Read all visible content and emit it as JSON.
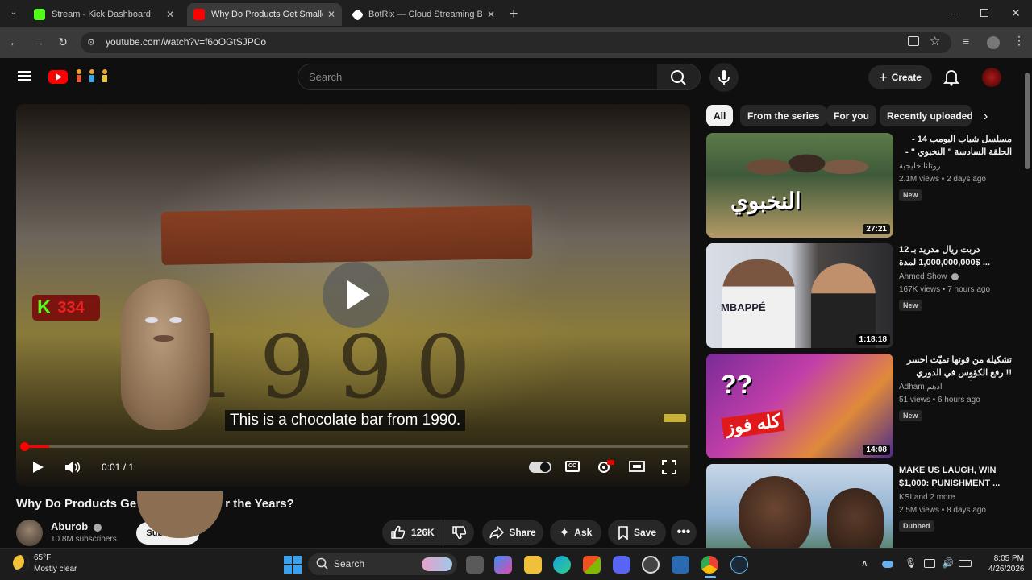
{
  "browser": {
    "tabs": [
      {
        "title": "Stream - Kick Dashboard",
        "fav_color": "#53fc18"
      },
      {
        "title": "Why Do Products Get Smaller C",
        "fav_color": "#ff0000"
      },
      {
        "title": "BotRix — Cloud Streaming Bot",
        "fav_color": "#ffffff"
      }
    ],
    "url": "youtube.com/watch?v=f6oOGtSJPCo"
  },
  "youtube": {
    "search_placeholder": "Search",
    "create_label": "Create"
  },
  "player": {
    "kick_count": "334",
    "caption": "This is a chocolate bar from 1990.",
    "year_text": "1990",
    "time": "0:01 / 1",
    "progress_fraction": 0.04
  },
  "video": {
    "title_left": "Why Do Products Ge",
    "title_right": "r the Years?",
    "channel": "Aburob",
    "subscribers": "10.8M subscribers",
    "subscribe_label": "Subscribe",
    "likes": "126K",
    "share_label": "Share",
    "ask_label": "Ask",
    "save_label": "Save"
  },
  "chips": [
    "All",
    "From the series",
    "For you",
    "Recently uploaded"
  ],
  "recommendations": [
    {
      "title": "مسلسل شباب البومب 14 - الحلقة السادسة \" النخبوي \" - 4K",
      "channel": "روتانا خليجية",
      "meta": "2.1M views • 2 days ago",
      "badge": "New",
      "duration": "27:21"
    },
    {
      "title": "دربت ريال مدريد بـ 12 $1,000,000,000 لمدة ...",
      "channel": "Ahmed Show",
      "meta": "167K views • 7 hours ago",
      "badge": "New",
      "duration": "1:18:18"
    },
    {
      "title": "تشكيلة من قوتها تميّت احسر !! رفع الكؤوس في الدوري العالمي - 🔥 ...",
      "channel": "Adham ادهم",
      "meta": "51 views • 6 hours ago",
      "badge": "New",
      "duration": "14:08"
    },
    {
      "title": "MAKE US LAUGH, WIN $1,000: PUNISHMENT ...",
      "channel": "KSI and 2 more",
      "meta": "2.5M views • 8 days ago",
      "badge": "Dubbed",
      "duration": ""
    }
  ],
  "thumb_texts": [
    "النخبوي",
    "MBAPPÉ",
    "كله فوز"
  ],
  "taskbar": {
    "temp": "65°F",
    "weather": "Mostly clear",
    "search": "Search",
    "time": "8:05 PM",
    "date": "4/26/2026"
  }
}
